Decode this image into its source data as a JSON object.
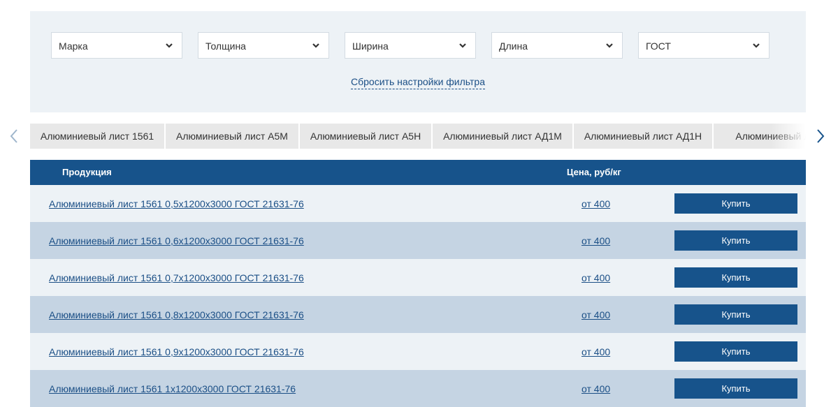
{
  "filters": {
    "selects": [
      {
        "label": "Марка",
        "icon": "chevron-down-icon"
      },
      {
        "label": "Толщина",
        "icon": "chevron-down-icon"
      },
      {
        "label": "Ширина",
        "icon": "chevron-down-icon"
      },
      {
        "label": "Длина",
        "icon": "chevron-down-icon"
      },
      {
        "label": "ГОСТ",
        "icon": "chevron-down-icon"
      }
    ],
    "reset_label": "Сбросить настройки фильтра"
  },
  "tabs": [
    {
      "label": "Алюминиевый лист 1561"
    },
    {
      "label": "Алюминиевый лист А5М"
    },
    {
      "label": "Алюминиевый лист А5Н"
    },
    {
      "label": "Алюминиевый лист АД1М"
    },
    {
      "label": "Алюминиевый лист АД1Н"
    },
    {
      "label": "Алюминиевый лист"
    }
  ],
  "nav_icons": {
    "prev": "chevron-left-icon",
    "next": "chevron-right-icon"
  },
  "table": {
    "headers": {
      "product": "Продукция",
      "price": "Цена, руб/кг"
    },
    "rows": [
      {
        "product": "Алюминиевый лист 1561 0,5х1200х3000 ГОСТ 21631-76",
        "price": "от 400",
        "buy": "Купить"
      },
      {
        "product": "Алюминиевый лист 1561 0,6х1200х3000 ГОСТ 21631-76",
        "price": "от 400",
        "buy": "Купить"
      },
      {
        "product": "Алюминиевый лист 1561 0,7х1200х3000 ГОСТ 21631-76",
        "price": "от 400",
        "buy": "Купить"
      },
      {
        "product": "Алюминиевый лист 1561 0,8х1200х3000 ГОСТ 21631-76",
        "price": "от 400",
        "buy": "Купить"
      },
      {
        "product": "Алюминиевый лист 1561 0,9х1200х3000 ГОСТ 21631-76",
        "price": "от 400",
        "buy": "Купить"
      },
      {
        "product": "Алюминиевый лист 1561 1х1200х3000 ГОСТ 21631-76",
        "price": "от 400",
        "buy": "Купить"
      }
    ]
  },
  "colors": {
    "brand": "#17538b",
    "row_light": "#edf2f6",
    "row_dark": "#c5d4e3",
    "link": "#1b4f86"
  }
}
